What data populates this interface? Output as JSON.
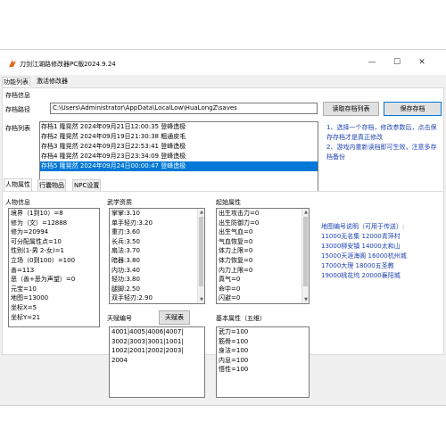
{
  "window": {
    "title": "刀剑江湖路修改器PC版2024.9.24",
    "controls": {
      "minimize": "—",
      "maximize": "☐",
      "close": "✕"
    }
  },
  "menu": {
    "items": [
      "功能列表",
      "激活修改器"
    ]
  },
  "archive": {
    "section_title": "存档信息",
    "path_label": "存档路径",
    "path_value": "C:\\Users\\Administrator\\AppData\\LocalLow\\HuaLongZ\\saves",
    "read_button": "读取存档列表",
    "save_button": "保存存档",
    "list_label": "存档列表",
    "saves": [
      "存档1 隆晃然  2024年09月21日12:00:35 登峰造极",
      "存档2 隆晃然  2024年09月19日21:30:38 粗通皮毛",
      "存档3 隆晃然  2024年09月23日22:53:41 登峰造极",
      "存档4 隆晃然  2024年09月23日23:34:09 登峰造极",
      "存档5 隆晃然  2024年09月24日00:00:47 登峰造极"
    ],
    "selected_index": 4,
    "instructions": [
      "1、选择一个存档，修改参数后，点击保存存档才是真正修改",
      "2、游戏内重新读档即可生效，注意多存档备份"
    ]
  },
  "tabs": [
    "人物属性",
    "行囊物品",
    "NPC设置"
  ],
  "character": {
    "title": "人物信息",
    "lines": [
      "境界（1到10）=8",
      "修为（文）=12888",
      "修为=20994",
      "可分配属性点=10",
      "性别(1-男 2-女)=1",
      "立场（0到100）=100",
      "善=113",
      "恶（善+恶为声望）=0",
      "元宝=10",
      "地图=13000",
      "坐标X=5",
      "坐标Y=21"
    ]
  },
  "martial": {
    "title": "武学资质",
    "lines": [
      "掌掌:3.10",
      "单手轻刃:3.20",
      "重刃:3.60",
      "长兵:3.50",
      "扇法:3.70",
      "暗器:3.80",
      "内功:3.40",
      "轻功:3.80",
      "腿脚:2.50",
      "双手轻刃:2.90"
    ]
  },
  "talent": {
    "title": "天赋编号",
    "button": "天赋表",
    "lines": [
      "4001|4005|4006|4007|",
      "3002|3003|3001|1001|",
      "1002|2001|2002|2003|",
      "2004"
    ]
  },
  "initial": {
    "title": "起始属性",
    "lines": [
      "出生攻击力=0",
      "出生防御力=0",
      "出生气血=0",
      "气血恢复=0",
      "体力上限=0",
      "体力恢复=0",
      "内力上限=0",
      "真气=0",
      "命中=0",
      "闪避=0"
    ]
  },
  "basic": {
    "title": "基本属性（五维）",
    "lines": [
      "武力=100",
      "筋骨=100",
      "身法=100",
      "内息=100",
      "悟性=100"
    ]
  },
  "map_note": {
    "lines": [
      "地图编号说明（可用于传送）:",
      "11000无名集    12000青萍村",
      "13000柳安镇    14000太和山",
      "15000天涯海阁  16000杭州城",
      "17000大理      18000五圣教",
      "19000桃花坞    20000襄阳城"
    ]
  },
  "colors": {
    "accent": "#0078d7",
    "note_blue": "#1a3fb4"
  }
}
